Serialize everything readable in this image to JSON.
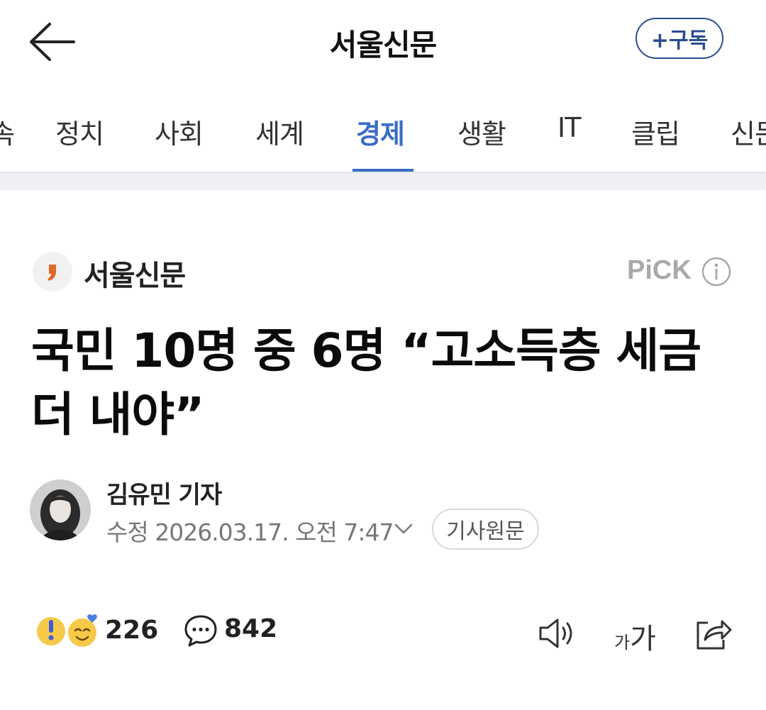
{
  "header": {
    "title": "서울신문",
    "subscribe_label": "+구독"
  },
  "tabs": [
    {
      "label": "속"
    },
    {
      "label": "정치"
    },
    {
      "label": "사회"
    },
    {
      "label": "세계"
    },
    {
      "label": "경제",
      "active": true
    },
    {
      "label": "생활"
    },
    {
      "label": "IT"
    },
    {
      "label": "클립"
    },
    {
      "label": "신문"
    }
  ],
  "press": {
    "name": "서울신문",
    "logo_glyph": "❜",
    "badge": "PiCK"
  },
  "article": {
    "headline": "국민 10명 중 6명 “고소득층 세금 더 내야”",
    "author": "김유민 기자",
    "date": "수정 2026.03.17. 오전 7:47",
    "original_label": "기사원문"
  },
  "actions": {
    "reaction_count": "226",
    "comment_count": "842",
    "font_small": "가",
    "font_big": "가"
  },
  "colors": {
    "accent": "#3a6cc6",
    "subscribe": "#2a4d8f",
    "press_logo": "#e06a2c"
  }
}
